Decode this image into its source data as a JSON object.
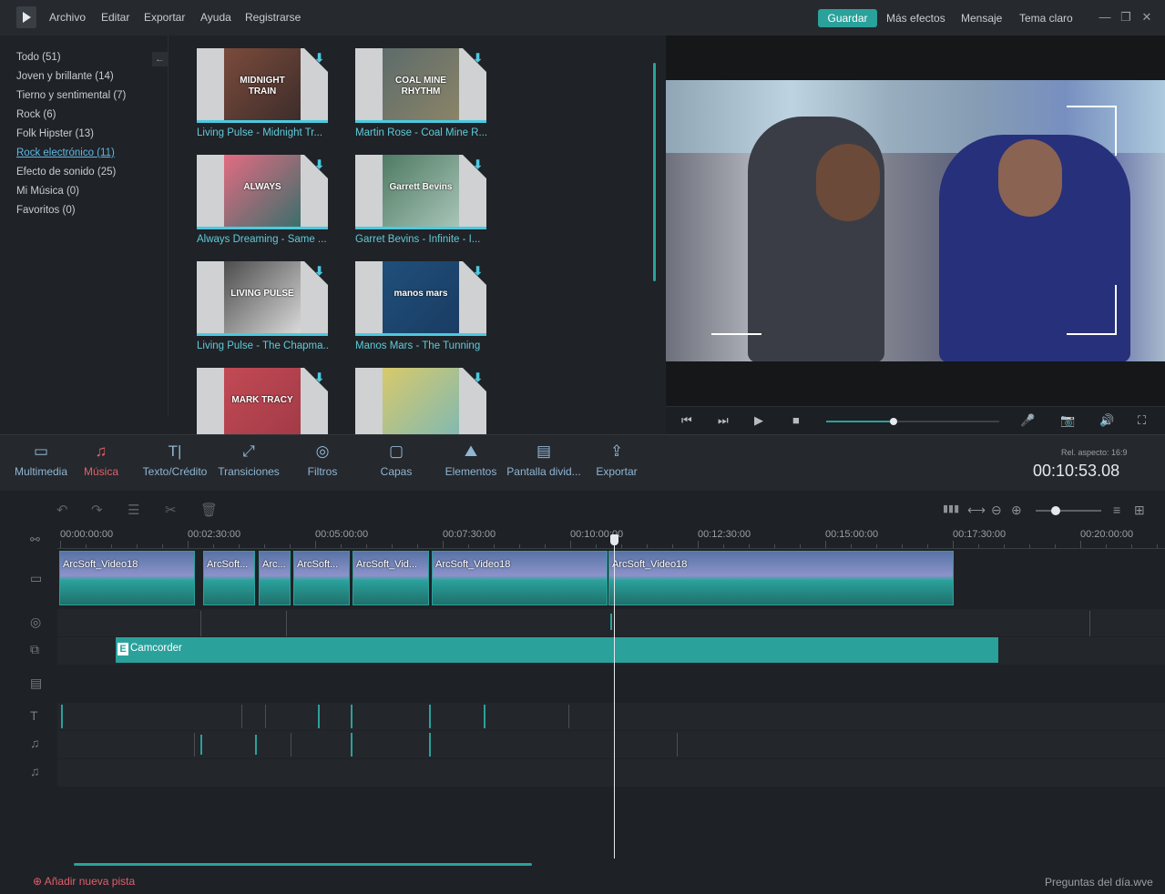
{
  "menu": {
    "items": [
      "Archivo",
      "Editar",
      "Exportar",
      "Ayuda",
      "Registrarse"
    ],
    "save_label": "Guardar",
    "more_effects": "Más efectos",
    "message": "Mensaje",
    "light_theme": "Tema claro",
    "minimize": "—",
    "maximize": "❐",
    "close": "✕"
  },
  "library": {
    "categories": [
      "Todo (51)",
      "Joven y brillante (14)",
      "Tierno y sentimental (7)",
      "Rock (6)",
      "Folk Hipster (13)",
      "Rock electrónico (11)",
      "Efecto de sonido (25)",
      "Mi Música (0)",
      "Favoritos (0)"
    ],
    "active_category_index": 5,
    "collapse_icon": "←",
    "download_icon": "⬇",
    "items": [
      {
        "label": "Living Pulse - Midnight Tr...",
        "art_text": "MIDNIGHT TRAIN",
        "colors": [
          "#7b4b3c",
          "#3d2d2a"
        ]
      },
      {
        "label": "Martin Rose - Coal Mine R...",
        "art_text": "COAL MINE RHYTHM",
        "colors": [
          "#5d6b6a",
          "#8a8468"
        ]
      },
      {
        "label": "Always Dreaming - Same ...",
        "art_text": "ALWAYS",
        "colors": [
          "#e36b82",
          "#3b6f6b"
        ]
      },
      {
        "label": "Garret Bevins - Infinite - I...",
        "art_text": "Garrett Bevins",
        "colors": [
          "#4f7a62",
          "#a8c4b8"
        ]
      },
      {
        "label": "Living Pulse - The Chapma...",
        "art_text": "LIVING PULSE",
        "colors": [
          "#4c4c4c",
          "#d9d9d9"
        ]
      },
      {
        "label": "Manos Mars - The Tunning",
        "art_text": "manos mars",
        "colors": [
          "#1f4f7a",
          "#1a3c63"
        ]
      },
      {
        "label": "",
        "art_text": "MARK TRACY",
        "colors": [
          "#c24a55",
          "#a13a46"
        ]
      },
      {
        "label": "",
        "art_text": "",
        "colors": [
          "#d8c96b",
          "#7fb9b3"
        ]
      }
    ]
  },
  "preview": {
    "controls": [
      "⏮",
      "⏭",
      "▶",
      "■",
      "🎤",
      "📷",
      "🔊",
      "⛶"
    ],
    "progress": 0.39
  },
  "toolbar": {
    "tools": [
      {
        "name": "multimedia",
        "label": "Multimedia",
        "icon": "▭"
      },
      {
        "name": "music",
        "label": "Música",
        "icon": "♫"
      },
      {
        "name": "text",
        "label": "Texto/Crédito",
        "icon": "T|"
      },
      {
        "name": "transitions",
        "label": "Transiciones",
        "icon": "⤢"
      },
      {
        "name": "filters",
        "label": "Filtros",
        "icon": "◎"
      },
      {
        "name": "overlays",
        "label": "Capas",
        "icon": "▢"
      },
      {
        "name": "elements",
        "label": "Elementos",
        "icon": "⛰"
      },
      {
        "name": "split-screen",
        "label": "Pantalla divid...",
        "icon": "▤"
      },
      {
        "name": "export",
        "label": "Exportar",
        "icon": "⇪"
      }
    ],
    "active_tool": "music",
    "aspect_label": "Rel. aspecto: 16:9",
    "timecode": "00:10:53.08"
  },
  "timeline": {
    "tools_left": [
      "↶",
      "↷",
      "☰",
      "✂",
      "🗑"
    ],
    "tools_right": [
      "▮▮▮",
      "⟷",
      "⊖",
      "⊕",
      "≡",
      "⊞"
    ],
    "zoom": 0.3,
    "ruler_ticks": [
      "00:00:00:00",
      "00:02:30:00",
      "00:05:00:00",
      "00:07:30:00",
      "00:10:00:00",
      "00:12:30:00",
      "00:15:00:00",
      "00:17:30:00",
      "00:20:00:00"
    ],
    "track_icons": [
      "▭",
      "◎",
      "⧉",
      "▤",
      "T",
      "♫",
      "♫"
    ],
    "video_clips": [
      "ArcSoft_Video18",
      "ArcSoft...",
      "Arc...",
      "ArcSoft...",
      "ArcSoft_Vid...",
      "ArcSoft_Video18",
      "ArcSoft_Video18"
    ],
    "overlay_clip": "Camcorder",
    "overlay_badge": "E",
    "add_track": "Añadir nueva pista",
    "add_icon": "⊕",
    "tips": "Preguntas del día.wve"
  }
}
